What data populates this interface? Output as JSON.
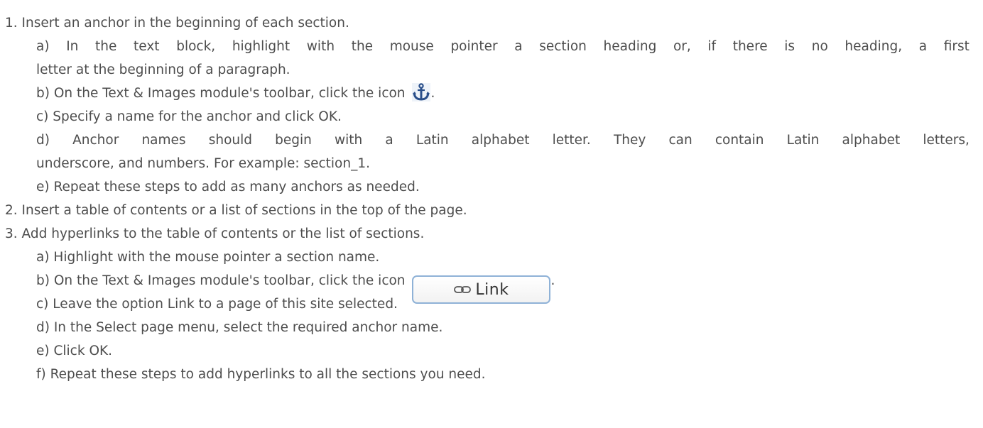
{
  "items": [
    {
      "text": "1. Insert an anchor in the beginning of each section.",
      "subitems": {
        "a_line1": "a) In the text block, highlight with the mouse pointer a section heading or, if there is no heading, a first",
        "a_line2": "letter at the beginning of a paragraph.",
        "b_text": "b) On the Text & Images module's toolbar, click the icon",
        "b_suffix": ".",
        "c": "c) Specify a name for the anchor and click OK.",
        "d_line1": "d) Anchor names should begin with a Latin alphabet letter. They can contain Latin alphabet letters,",
        "d_line2": "underscore, and numbers. For example: section_1.",
        "e": "e) Repeat these steps to add as many anchors as needed."
      }
    },
    {
      "text": "2. Insert a table of contents or a list of sections in the top of the page."
    },
    {
      "text": "3. Add hyperlinks to the table of contents or the list of sections.",
      "subitems": {
        "a": "a) Highlight with the mouse pointer a section name.",
        "b_text": "b) On the Text & Images module's toolbar, click the icon",
        "b_suffix": ".",
        "c": "c) Leave the option Link to a page of this site selected.",
        "d": "d) In the Select page menu, select the required anchor name.",
        "e": "e) Click OK.",
        "f": "f) Repeat these steps to add hyperlinks to all the sections you need."
      }
    }
  ],
  "icons": {
    "anchor_icon": "anchor-icon",
    "link_button_label": "Link",
    "link_button_icon": "chain-link-icon",
    "anchor_color": "#2a4f8a"
  }
}
